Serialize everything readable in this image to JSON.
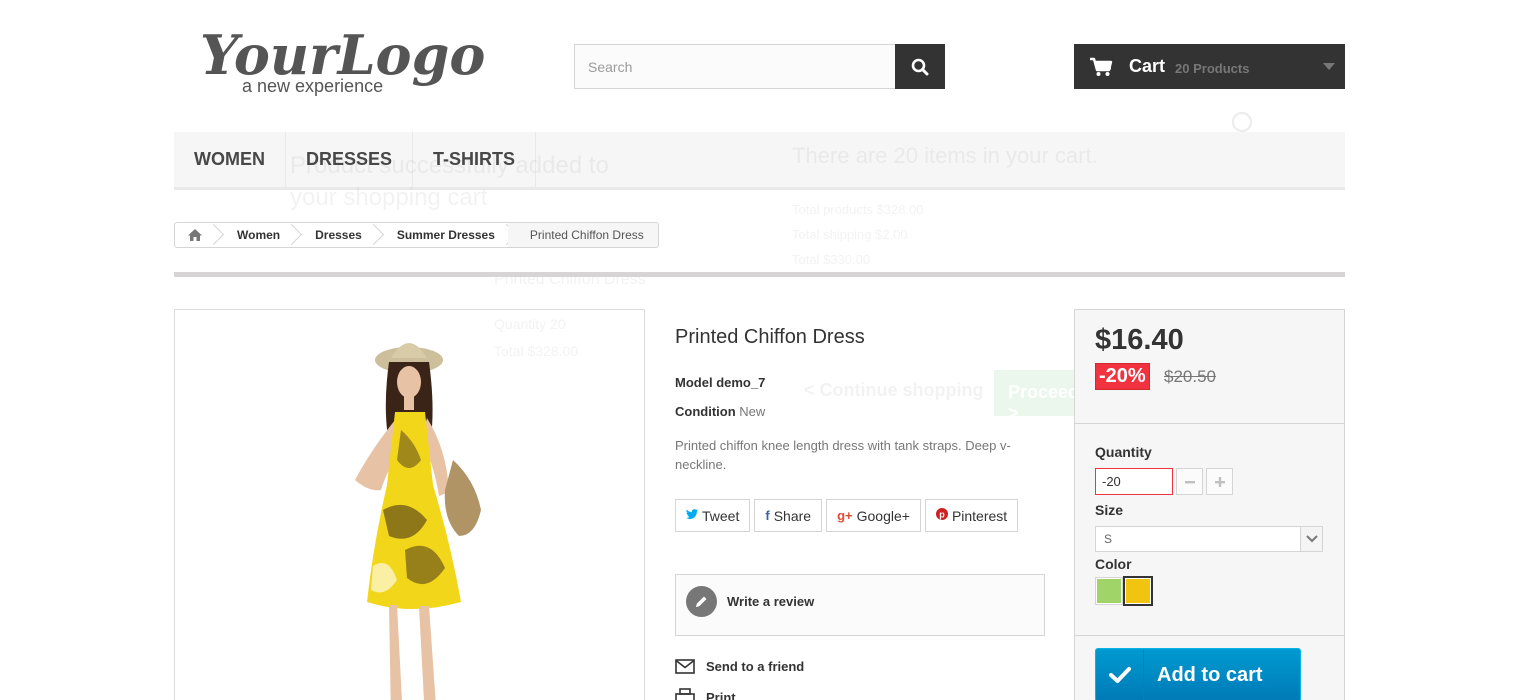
{
  "header": {
    "logo_main": "YourLogo",
    "logo_tagline": "a new experience",
    "search_placeholder": "Search",
    "search_icon": "search-icon",
    "cart_label": "Cart",
    "cart_count": "20 Products"
  },
  "menu": [
    {
      "label": "Women"
    },
    {
      "label": "Dresses"
    },
    {
      "label": "T-shirts"
    }
  ],
  "breadcrumb": {
    "home_icon": "home-icon",
    "items": [
      "Women",
      "Dresses",
      "Summer Dresses"
    ],
    "current": "Printed Chiffon Dress"
  },
  "ghost_layer": {
    "added_text": "Product successfully added to your shopping cart",
    "cart_items_text": "There are 20 items in your cart.",
    "total_products": "Total products $328.00",
    "total_shipping": "Total shipping $2.00",
    "total": "Total $330.00",
    "product_name": "Printed Chiffon Dress",
    "quantity": "Quantity 20",
    "product_total": "Total $328.00",
    "continue_btn": "< Continue shopping",
    "checkout_btn": "Proceed to checkout >"
  },
  "product": {
    "title": "Printed Chiffon Dress",
    "model_label": "Model",
    "model_value": "demo_7",
    "condition_label": "Condition",
    "condition_value": "New",
    "description": "Printed chiffon knee length dress with tank straps. Deep v-neckline.",
    "socials": [
      {
        "icon": "twitter-icon",
        "glyph": "🐦",
        "label": "Tweet",
        "color": "#00aaf0"
      },
      {
        "icon": "facebook-icon",
        "glyph": "f",
        "label": "Share",
        "color": "#435f9f"
      },
      {
        "icon": "googleplus-icon",
        "glyph": "g+",
        "label": "Google+",
        "color": "#e04b34"
      },
      {
        "icon": "pinterest-icon",
        "glyph": "p",
        "label": "Pinterest",
        "color": "#ce1f21"
      }
    ],
    "review_label": "Write a review",
    "send_friend": "Send to a friend",
    "print": "Print"
  },
  "buy": {
    "price": "$16.40",
    "reduction": "-20%",
    "old_price": "$20.50",
    "quantity_label": "Quantity",
    "quantity_value": "-20",
    "size_label": "Size",
    "size_value": "S",
    "color_label": "Color",
    "colors": [
      {
        "name": "Green",
        "hex": "#a0d468",
        "selected": false
      },
      {
        "name": "Yellow",
        "hex": "#f1c40f",
        "selected": true
      }
    ],
    "add_to_cart": "Add to cart"
  },
  "colors": {
    "dark": "#333333",
    "accent_red": "#f13340",
    "cart_blue": "#009ad0"
  }
}
